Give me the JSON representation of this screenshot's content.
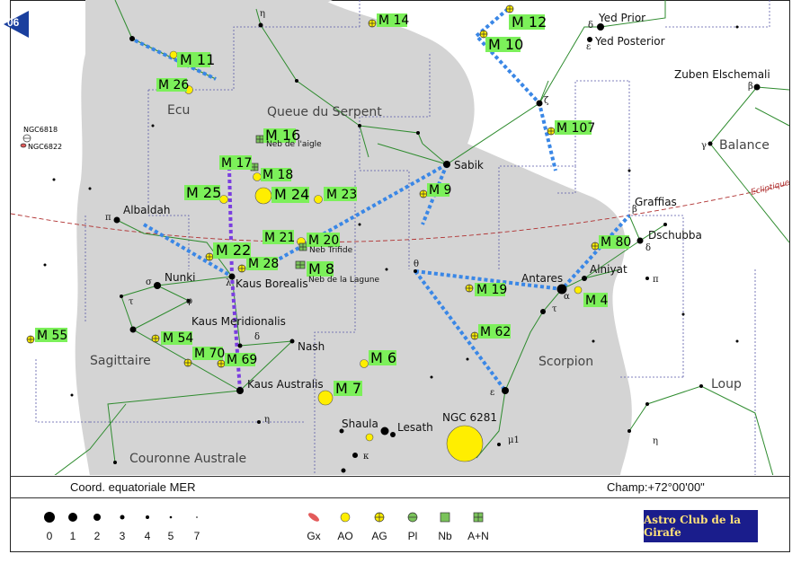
{
  "page_badge": "06",
  "constellations": [
    "Ecu",
    "Queue du Serpent",
    "Sagittaire",
    "Scorpion",
    "Balance",
    "Loup",
    "Couronne Australe"
  ],
  "stars": {
    "yed_prior": "Yed Prior",
    "yed_posterior": "Yed Posterior",
    "zuben": "Zuben Elschemali",
    "sabik": "Sabik",
    "albaldah": "Albaldah",
    "nunki": "Nunki",
    "kaus_borealis": "Kaus Borealis",
    "kaus_medi": "Kaus Meridionalis",
    "kaus_australis": "Kaus Australis",
    "nash": "Nash",
    "shaula": "Shaula",
    "lesath": "Lesath",
    "antares": "Antares",
    "alniyat": "Alniyat",
    "dschubba": "Dschubba",
    "graffias": "Graffias"
  },
  "messier": [
    "M 14",
    "M 12",
    "M 10",
    "M 11",
    "M 26",
    "M 16",
    "M 107",
    "M 17",
    "M 18",
    "M 24",
    "M 23",
    "M 25",
    "M 9",
    "M 21",
    "M 20",
    "M 22",
    "M 28",
    "M 8",
    "M 80",
    "M 19",
    "M 4",
    "M 55",
    "M 54",
    "M 62",
    "M 70",
    "M 69",
    "M 6",
    "M 7"
  ],
  "nebulae": {
    "eagle": "Neb de l'aigle",
    "trifid": "Neb Trifide",
    "lagoon": "Neb de la Lagune"
  },
  "ngc": [
    "NGC6818",
    "NGC6822",
    "NGC 6281"
  ],
  "ecliptic_label": "Ecliptique",
  "greek": {
    "eta1": "η",
    "delta": "δ",
    "epsilon": "ε",
    "zeta": "ζ",
    "beta": "β",
    "gamma": "γ",
    "pi": "π",
    "sigma": "σ",
    "phi": "φ",
    "tau": "τ",
    "lambda": "λ",
    "theta": "θ",
    "alpha": "α",
    "kappa": "κ",
    "mu1": "μ1",
    "eta2": "η",
    "eta3": "η",
    "eps2": "ε",
    "delta2": "δ",
    "pi2": "π",
    "tau2": "τ",
    "beta2": "β",
    "delta3": "δ"
  },
  "footer": {
    "coord": "Coord. equatoriale MER",
    "champ": "Champ:+72°00'00\""
  },
  "legend_magnitudes": [
    "0",
    "1",
    "2",
    "3",
    "4",
    "5",
    "7"
  ],
  "legend_types": [
    "Gx",
    "AO",
    "AG",
    "Pl",
    "Nb",
    "A+N"
  ],
  "logo_text": "Astro Club de la Girafe",
  "colors": {
    "milky_way": "#d4d4d4",
    "star_line": "#2e8b2e",
    "asterism": "#3a87e6",
    "asterism_teapot": "#7a3de0",
    "ecliptic": "#b03030",
    "boundary": "#5a5aa8",
    "label_bg": "#7cf05a",
    "cluster": "#ffee00"
  }
}
